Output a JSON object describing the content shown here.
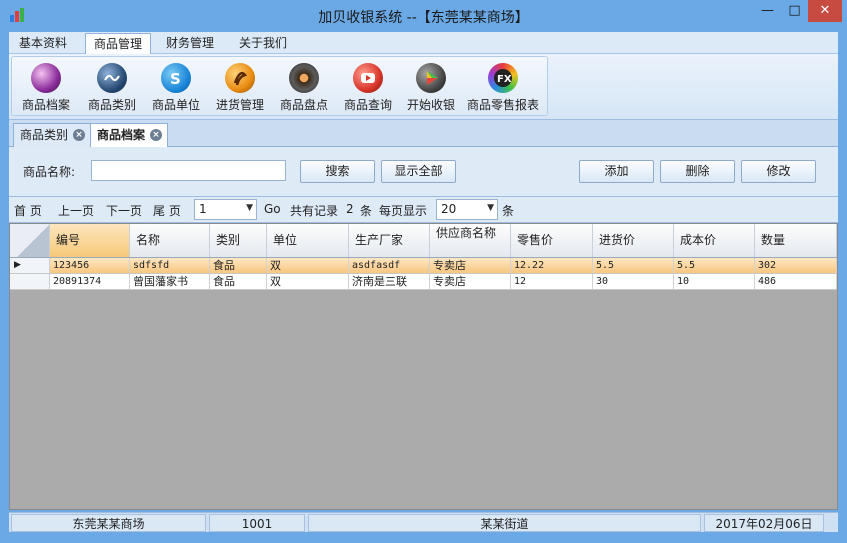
{
  "window": {
    "title": "加贝收银系统 --【东莞某某商场】"
  },
  "menu": {
    "items": [
      "基本资料",
      "商品管理",
      "财务管理",
      "关于我们"
    ],
    "active": "商品管理"
  },
  "ribbon": {
    "buttons": [
      {
        "label": "商品档案",
        "icon": "product-file-icon"
      },
      {
        "label": "商品类别",
        "icon": "product-category-icon"
      },
      {
        "label": "商品单位",
        "icon": "product-unit-icon"
      },
      {
        "label": "进货管理",
        "icon": "purchase-icon"
      },
      {
        "label": "商品盘点",
        "icon": "inventory-icon"
      },
      {
        "label": "商品查询",
        "icon": "query-icon"
      },
      {
        "label": "开始收银",
        "icon": "cashier-icon"
      },
      {
        "label": "商品零售报表",
        "icon": "report-icon"
      }
    ]
  },
  "tabs": [
    {
      "label": "商品类别",
      "active": false
    },
    {
      "label": "商品档案",
      "active": true
    }
  ],
  "search": {
    "label": "商品名称:",
    "value": "",
    "search_button": "搜索",
    "show_all_button": "显示全部",
    "add_button": "添加",
    "delete_button": "删除",
    "edit_button": "修改"
  },
  "pager": {
    "first": "首 页",
    "prev": "上一页",
    "next": "下一页",
    "last": "尾 页",
    "page": "1",
    "go": "Go",
    "total_prefix": "共有记录",
    "total": "2",
    "total_suffix": "条",
    "per_page_label": "每页显示",
    "per_page": "20",
    "per_page_suffix": "条"
  },
  "table": {
    "columns": [
      "编号",
      "名称",
      "类别",
      "单位",
      "生产厂家",
      "供应商名称",
      "零售价",
      "进货价",
      "成本价",
      "数量"
    ],
    "rows": [
      [
        "123456",
        "sdfsfd",
        "食品",
        "双",
        "asdfasdf",
        "专卖店",
        "12.22",
        "5.5",
        "5.5",
        "302"
      ],
      [
        "20891374",
        "曾国藩家书",
        "食品",
        "双",
        "济南是三联",
        "专卖店",
        "12",
        "30",
        "10",
        "486"
      ]
    ],
    "selected_row": 0
  },
  "status": {
    "store": "东莞某某商场",
    "code": "1001",
    "address": "某某街道",
    "date": "2017年02月06日"
  }
}
